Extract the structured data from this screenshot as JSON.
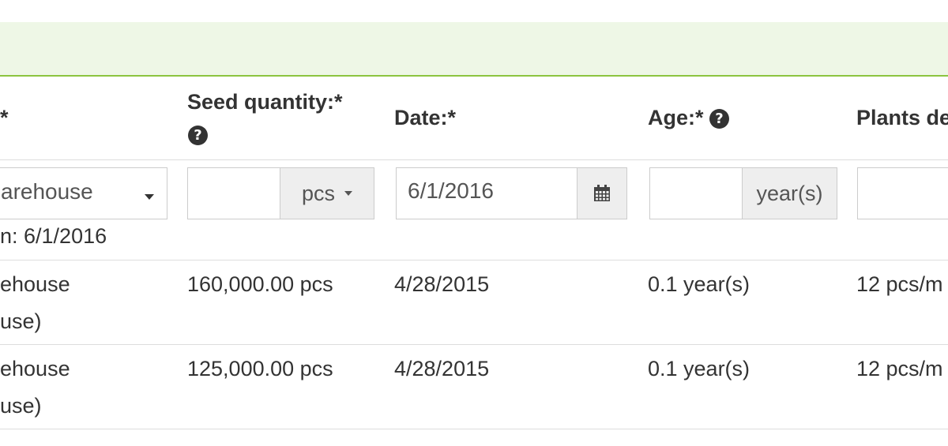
{
  "header": {
    "col_storage_suffix": "*",
    "col_seed_quantity": "Seed quantity:*",
    "col_date": "Date:*",
    "col_age": "Age:*",
    "col_plants": "Plants de"
  },
  "form": {
    "storage_value": "arehouse",
    "storage_note": "n: 6/1/2016",
    "quantity_value": "",
    "quantity_unit": "pcs",
    "date_value": "6/1/2016",
    "age_value": "",
    "age_unit": "year(s)",
    "plants_value": ""
  },
  "rows": [
    {
      "storage_line1": "ehouse",
      "storage_line2": "use)",
      "quantity": "160,000.00 pcs",
      "date": "4/28/2015",
      "age": "0.1 year(s)",
      "plants": "12 pcs/m"
    },
    {
      "storage_line1": "ehouse",
      "storage_line2": "use)",
      "quantity": "125,000.00 pcs",
      "date": "4/28/2015",
      "age": "0.1 year(s)",
      "plants": "12 pcs/m"
    }
  ],
  "icons": {
    "help": "question-circle-icon",
    "calendar": "calendar-icon",
    "dropdown": "caret-down-icon"
  },
  "colors": {
    "band_background": "#eef7e6",
    "band_border": "#8cc43f",
    "addon_background": "#eeeeee"
  }
}
